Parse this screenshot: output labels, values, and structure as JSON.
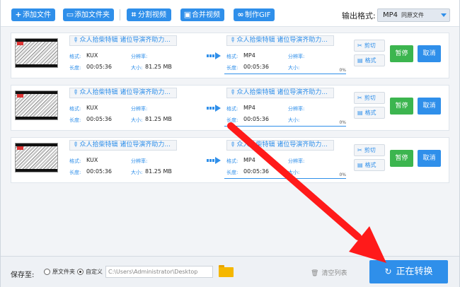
{
  "toolbar": {
    "add_file": "添加文件",
    "add_folder": "添加文件夹",
    "split_video": "分割视频",
    "merge_video": "合并视频",
    "make_gif": "制作GIF",
    "format_label": "输出格式:",
    "format_value": "MP4",
    "format_sub": "同原文件"
  },
  "labels": {
    "format": "格式:",
    "duration": "长度:",
    "resolution": "分辨率:",
    "size": "大小:",
    "cut": "剪切",
    "fmt": "格式",
    "pause": "暂停",
    "cancel": "取消"
  },
  "files": [
    {
      "title": "众人拾柴特辑 诸位导演齐助力...",
      "src_format": "KUX",
      "src_duration": "00:05:36",
      "src_size": "81.25 MB",
      "dst_title": "众人拾柴特辑 诸位导演齐助力...",
      "dst_format": "MP4",
      "dst_duration": "00:05:36",
      "progress": "0%"
    },
    {
      "title": "众人拾柴特辑 诸位导演齐助力...",
      "src_format": "KUX",
      "src_duration": "00:05:36",
      "src_size": "81.25 MB",
      "dst_title": "众人拾柴特辑 诸位导演齐助力...",
      "dst_format": "MP4",
      "dst_duration": "00:05:36",
      "progress": "0%"
    },
    {
      "title": "众人拾柴特辑 诸位导演齐助力...",
      "src_format": "KUX",
      "src_duration": "00:05:36",
      "src_size": "81.25 MB",
      "dst_title": "众人拾柴特辑 诸位导演齐助力...",
      "dst_format": "MP4",
      "dst_duration": "00:05:36",
      "progress": "0%"
    }
  ],
  "bottom": {
    "save_to": "保存至:",
    "option_original": "原文件夹",
    "option_custom": "自定义",
    "path": "C:\\Users\\Administrator\\Desktop",
    "clear_list": "清空列表",
    "start": "正在转换"
  },
  "colors": {
    "accent": "#2f8fea",
    "pause": "#3cb54f",
    "overlay_arrow": "#ff1a1a",
    "folder": "#f5b700"
  }
}
